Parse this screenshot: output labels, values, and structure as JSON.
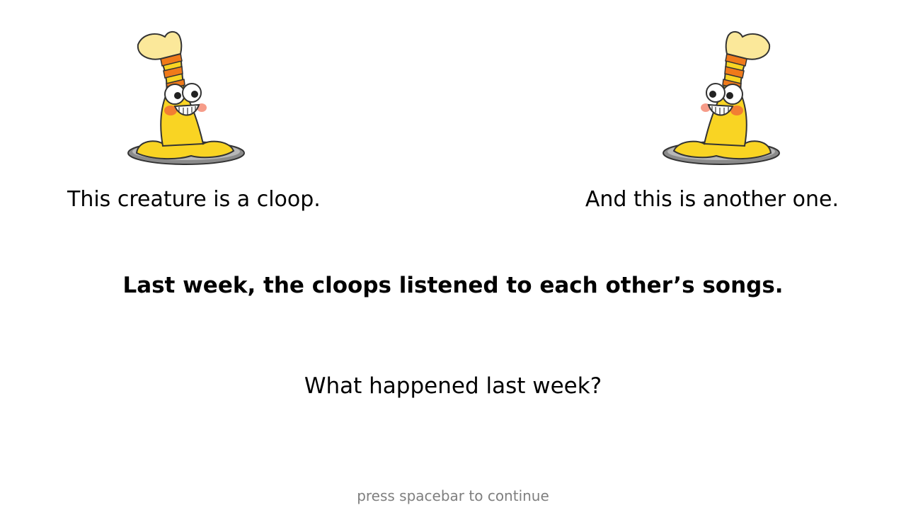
{
  "slide": {
    "left_caption": "This creature is a cloop.",
    "right_caption": "And this is another one.",
    "statement": "Last week, the cloops listened to each other’s songs.",
    "question": "What happened last week?",
    "hint": "press spacebar to continue"
  },
  "creatures": [
    {
      "name": "cloop",
      "icon": "cloop-creature-icon",
      "facing": "right"
    },
    {
      "name": "cloop",
      "icon": "cloop-creature-icon",
      "facing": "left"
    }
  ],
  "colors": {
    "background": "#ffffff",
    "text": "#000000",
    "hint_text": "#7f7f7f",
    "creature_body": "#f9d423",
    "creature_stripe": "#f07a1a",
    "creature_cheek": "#f05a3a"
  }
}
